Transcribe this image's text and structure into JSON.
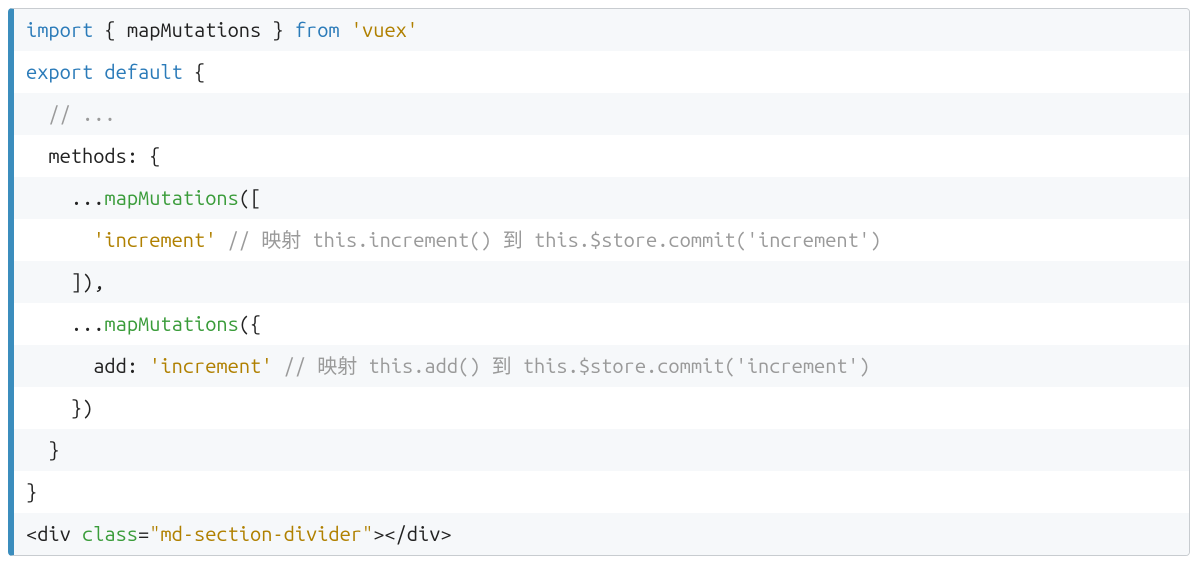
{
  "code": {
    "line1": {
      "import": "import",
      "lbrace": " { ",
      "name": "mapMutations",
      "rbrace": " } ",
      "from": "from",
      "sp": " ",
      "str": "'vuex'"
    },
    "line2": {
      "export": "export",
      "sp1": " ",
      "default": "default",
      "sp2": " ",
      "brace": "{"
    },
    "line3": {
      "indent": "  ",
      "comment": "// ..."
    },
    "line4": {
      "indent": "  ",
      "label": "methods",
      "colon": ": ",
      "brace": "{"
    },
    "line5": {
      "indent": "    ",
      "spread": "...",
      "fn": "mapMutations",
      "open": "(["
    },
    "line6": {
      "indent": "      ",
      "str": "'increment'",
      "sp": " ",
      "comment": "// 映射 this.increment() 到 this.$store.commit('increment')"
    },
    "line7": {
      "indent": "    ",
      "close": "]),"
    },
    "line8": {
      "indent": "    ",
      "spread": "...",
      "fn": "mapMutations",
      "open": "({"
    },
    "line9": {
      "indent": "      ",
      "key": "add",
      "colon": ": ",
      "str": "'increment'",
      "sp": " ",
      "comment": "// 映射 this.add() 到 this.$store.commit('increment')"
    },
    "line10": {
      "indent": "    ",
      "close": "})"
    },
    "line11": {
      "indent": "  ",
      "brace": "}"
    },
    "line12": {
      "brace": "}"
    },
    "line13": {
      "open": "<div ",
      "attr": "class",
      "eq": "=",
      "val": "\"md-section-divider\"",
      "close": "></div>"
    }
  }
}
